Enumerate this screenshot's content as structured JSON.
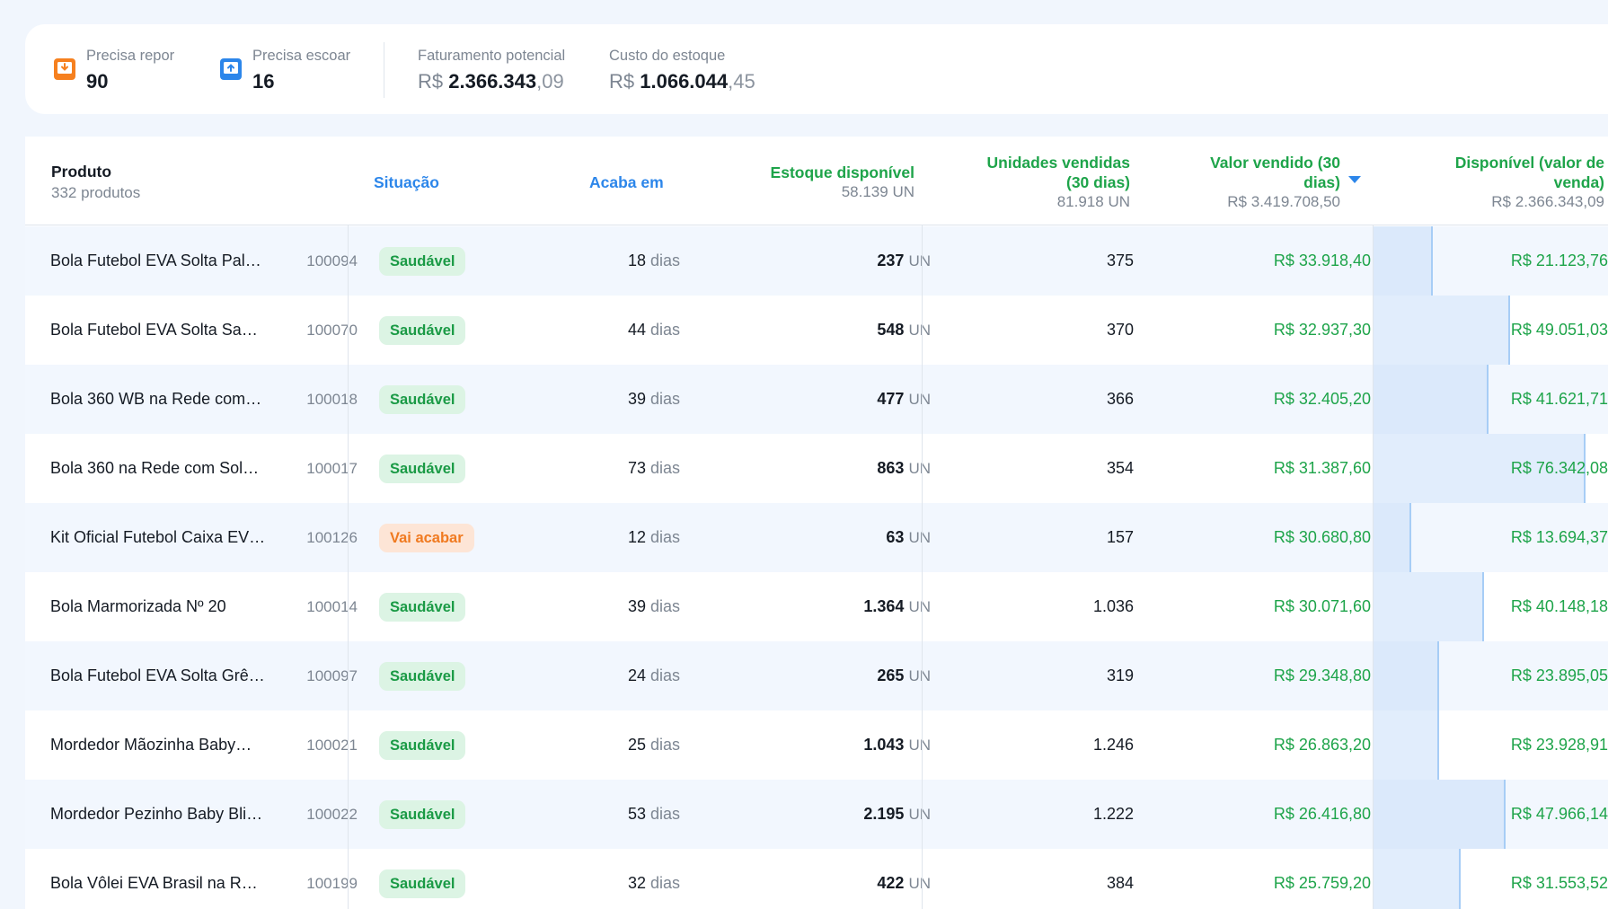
{
  "summary": {
    "repor": {
      "label": "Precisa repor",
      "value": "90",
      "icon": "restock-down-icon",
      "color": "#f6801f"
    },
    "escoar": {
      "label": "Precisa escoar",
      "value": "16",
      "icon": "restock-up-icon",
      "color": "#2c86ea"
    },
    "faturamento": {
      "label": "Faturamento potencial",
      "currency": "R$",
      "int": "2.366.343",
      "cents": ",09"
    },
    "custo": {
      "label": "Custo do estoque",
      "currency": "R$",
      "int": "1.066.044",
      "cents": ",45"
    }
  },
  "columns": {
    "produto": {
      "label": "Produto",
      "sub": "332 produtos"
    },
    "situacao": {
      "label": "Situação"
    },
    "acaba": {
      "label": "Acaba em"
    },
    "estoque": {
      "label": "Estoque disponível",
      "sub": "58.139 UN"
    },
    "unidades": {
      "label1": "Unidades vendidas",
      "label2": "(30 dias)",
      "sub": "81.918 UN"
    },
    "valor": {
      "label1": "Valor vendido (30",
      "label2": "dias)",
      "sub": "R$ 3.419.708,50"
    },
    "disponivel": {
      "label1": "Disponível (valor de",
      "label2": "venda)",
      "sub": "R$ 2.366.343,09"
    }
  },
  "colors": {
    "accent_blue": "#2c86ea",
    "accent_green": "#1ea44a",
    "status_ok": "#1a9a45",
    "status_warn": "#f07a20"
  },
  "rows": [
    {
      "name": "Bola Futebol EVA Solta Pal…",
      "sku": "100094",
      "status": "Saudável",
      "status_type": "ok",
      "days": "18",
      "days_unit": "dias",
      "stock": "237",
      "stock_unit": "UN",
      "sold": "375",
      "value_sold": "R$ 33.918,40",
      "available": "R$ 21.123,76",
      "available_bar": 0.25
    },
    {
      "name": "Bola Futebol EVA Solta San…",
      "sku": "100070",
      "status": "Saudável",
      "status_type": "ok",
      "days": "44",
      "days_unit": "dias",
      "stock": "548",
      "stock_unit": "UN",
      "sold": "370",
      "value_sold": "R$ 32.937,30",
      "available": "R$ 49.051,03",
      "available_bar": 0.58
    },
    {
      "name": "Bola 360 WB na Rede com…",
      "sku": "100018",
      "status": "Saudável",
      "status_type": "ok",
      "days": "39",
      "days_unit": "dias",
      "stock": "477",
      "stock_unit": "UN",
      "sold": "366",
      "value_sold": "R$ 32.405,20",
      "available": "R$ 41.621,71",
      "available_bar": 0.49
    },
    {
      "name": "Bola 360 na Rede com Sola…",
      "sku": "100017",
      "status": "Saudável",
      "status_type": "ok",
      "days": "73",
      "days_unit": "dias",
      "stock": "863",
      "stock_unit": "UN",
      "sold": "354",
      "value_sold": "R$ 31.387,60",
      "available": "R$ 76.342,08",
      "available_bar": 0.9
    },
    {
      "name": "Kit Oficial Futebol Caixa EV…",
      "sku": "100126",
      "status": "Vai acabar",
      "status_type": "warn",
      "days": "12",
      "days_unit": "dias",
      "stock": "63",
      "stock_unit": "UN",
      "sold": "157",
      "value_sold": "R$ 30.680,80",
      "available": "R$ 13.694,37",
      "available_bar": 0.16
    },
    {
      "name": "Bola Marmorizada Nº 20",
      "sku": "100014",
      "status": "Saudável",
      "status_type": "ok",
      "days": "39",
      "days_unit": "dias",
      "stock": "1.364",
      "stock_unit": "UN",
      "sold": "1.036",
      "value_sold": "R$ 30.071,60",
      "available": "R$ 40.148,18",
      "available_bar": 0.47
    },
    {
      "name": "Bola Futebol EVA Solta Grê…",
      "sku": "100097",
      "status": "Saudável",
      "status_type": "ok",
      "days": "24",
      "days_unit": "dias",
      "stock": "265",
      "stock_unit": "UN",
      "sold": "319",
      "value_sold": "R$ 29.348,80",
      "available": "R$ 23.895,05",
      "available_bar": 0.28
    },
    {
      "name": "Mordedor Mãozinha Baby…",
      "sku": "100021",
      "status": "Saudável",
      "status_type": "ok",
      "days": "25",
      "days_unit": "dias",
      "stock": "1.043",
      "stock_unit": "UN",
      "sold": "1.246",
      "value_sold": "R$ 26.863,20",
      "available": "R$ 23.928,91",
      "available_bar": 0.28
    },
    {
      "name": "Mordedor Pezinho Baby Bli…",
      "sku": "100022",
      "status": "Saudável",
      "status_type": "ok",
      "days": "53",
      "days_unit": "dias",
      "stock": "2.195",
      "stock_unit": "UN",
      "sold": "1.222",
      "value_sold": "R$ 26.416,80",
      "available": "R$ 47.966,14",
      "available_bar": 0.56
    },
    {
      "name": "Bola Vôlei EVA Brasil na Re…",
      "sku": "100199",
      "status": "Saudável",
      "status_type": "ok",
      "days": "32",
      "days_unit": "dias",
      "stock": "422",
      "stock_unit": "UN",
      "sold": "384",
      "value_sold": "R$ 25.759,20",
      "available": "R$ 31.553,52",
      "available_bar": 0.37
    }
  ]
}
